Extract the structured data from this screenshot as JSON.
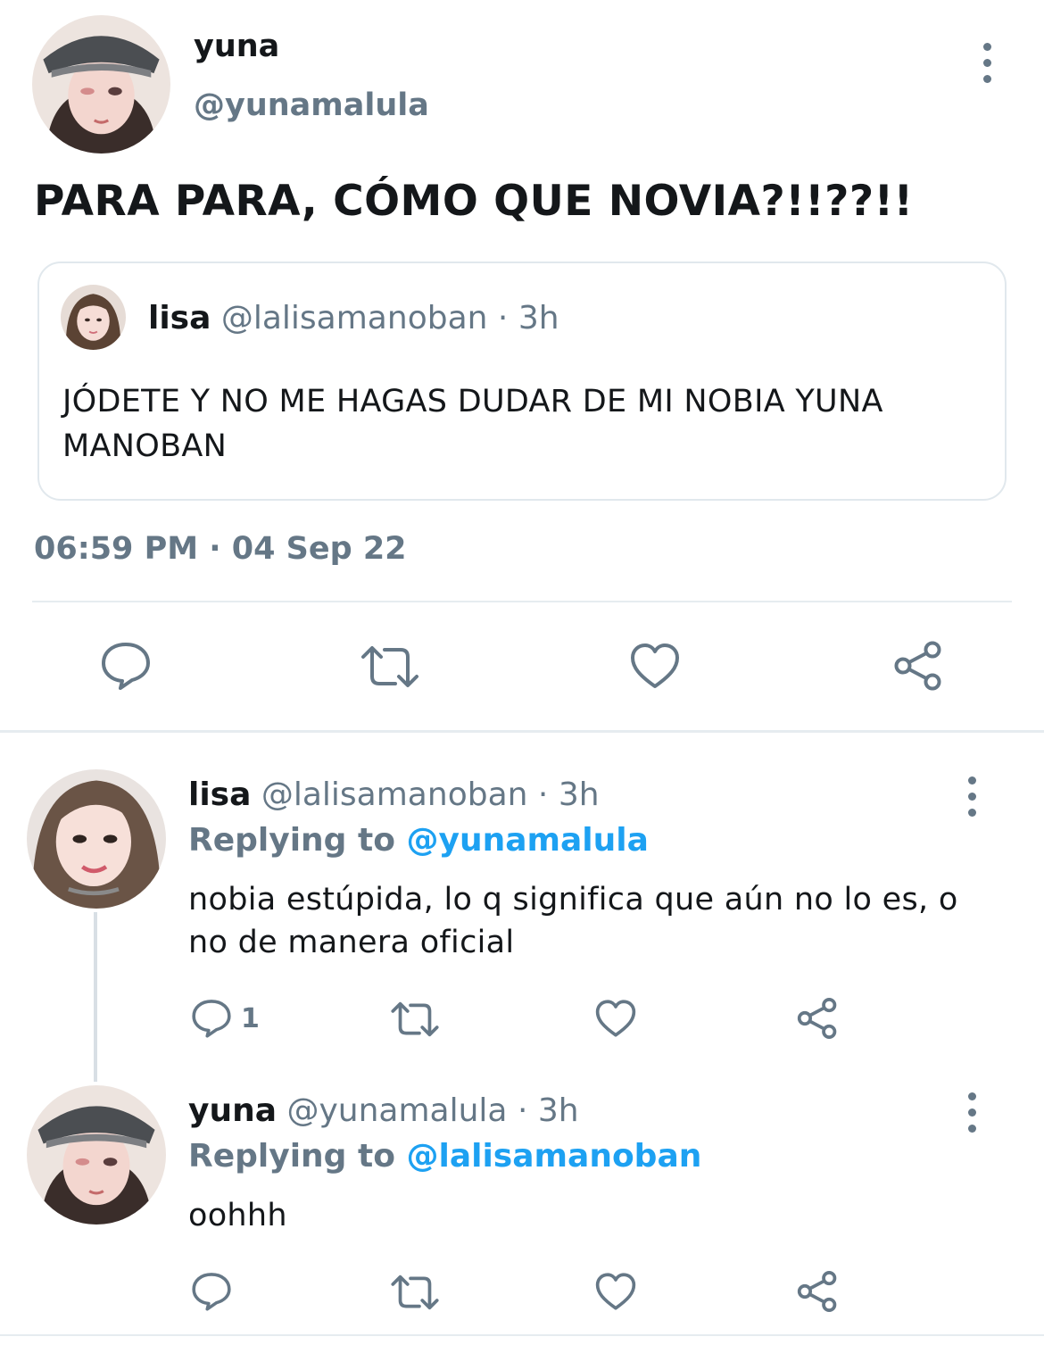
{
  "main_tweet": {
    "author_name": "yuna",
    "author_handle": "@yunamalula",
    "text": "PARA PARA, CÓMO QUE NOVIA?!!??!!",
    "timestamp": "06:59 PM · 04 Sep 22",
    "quoted": {
      "author_name": "lisa",
      "author_handle": "@lalisamanoban",
      "separator": "·",
      "time": "3h",
      "text": "JÓDETE Y NO ME HAGAS DUDAR DE MI NOBIA YUNA MANOBAN"
    },
    "actions": [
      {
        "icon": "reply-icon"
      },
      {
        "icon": "retweet-icon"
      },
      {
        "icon": "like-icon"
      },
      {
        "icon": "share-icon"
      }
    ]
  },
  "replies": [
    {
      "author_name": "lisa",
      "author_handle": "@lalisamanoban",
      "separator": "·",
      "time": "3h",
      "replying_label": "Replying to",
      "replying_handle": "@yunamalula",
      "text": "nobia estúpida, lo q significa que aún no lo es, o no de manera oficial",
      "reply_count": "1"
    },
    {
      "author_name": "yuna",
      "author_handle": "@yunamalula",
      "separator": "·",
      "time": "3h",
      "replying_label": "Replying to",
      "replying_handle": "@lalisamanoban",
      "text": "oohhh",
      "reply_count": ""
    }
  ],
  "colors": {
    "text": "#14171a",
    "muted": "#657786",
    "link": "#1da1f2",
    "border": "#e1e8ed"
  }
}
